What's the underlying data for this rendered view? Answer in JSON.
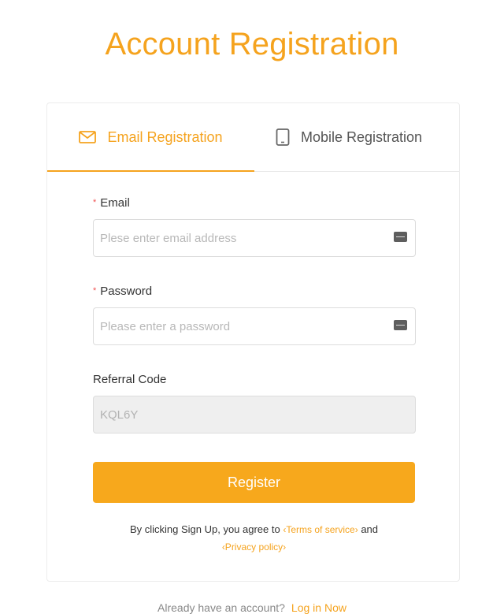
{
  "page_title": "Account Registration",
  "tabs": {
    "email_label": "Email Registration",
    "mobile_label": "Mobile Registration"
  },
  "form": {
    "email": {
      "required_mark": "*",
      "label": "Email",
      "placeholder": "Plese enter email address",
      "value": ""
    },
    "password": {
      "required_mark": "*",
      "label": "Password",
      "placeholder": "Please enter a password",
      "value": ""
    },
    "referral": {
      "label": "Referral Code",
      "value": "KQL6Y"
    },
    "register_label": "Register"
  },
  "agreement": {
    "prefix": "By clicking Sign Up, you agree to",
    "terms_label": "‹Terms of service›",
    "and_text": "and",
    "privacy_label": "‹Privacy policy›"
  },
  "footer": {
    "prompt": "Already have an account?",
    "login_label": "Log in Now"
  },
  "colors": {
    "accent": "#f5a31e",
    "button": "#f7a81c",
    "required": "#f05050"
  },
  "icons": {
    "email_tab": "envelope-icon",
    "mobile_tab": "phone-icon",
    "field_action": "keyboard-icon"
  }
}
